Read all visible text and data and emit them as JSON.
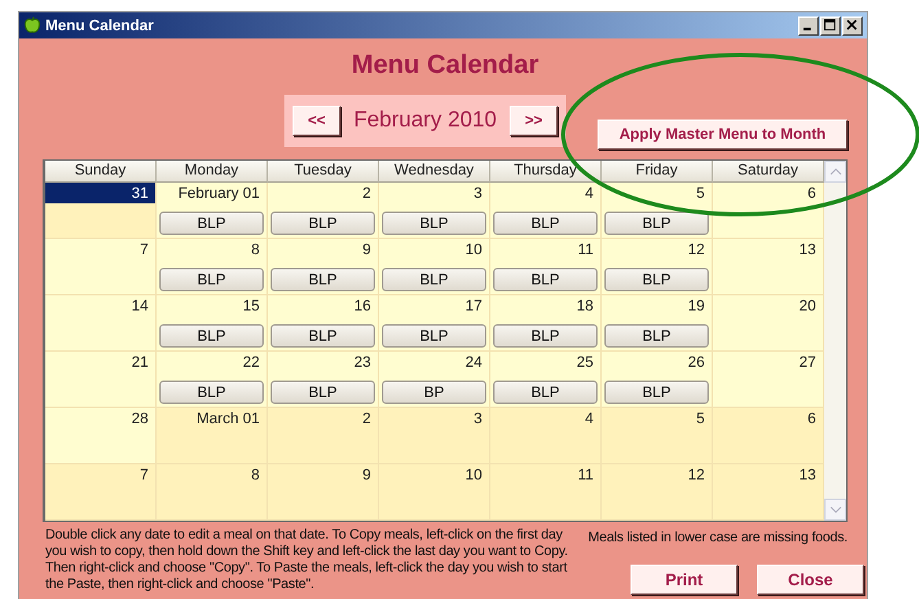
{
  "window": {
    "title": "Menu Calendar"
  },
  "heading": "Menu Calendar",
  "nav": {
    "prev": "<<",
    "month": "February 2010",
    "next": ">>"
  },
  "apply_button": "Apply Master Menu to Month",
  "columns": [
    "Sunday",
    "Monday",
    "Tuesday",
    "Wednesday",
    "Thursday",
    "Friday",
    "Saturday"
  ],
  "weeks": [
    [
      {
        "label": "31",
        "in_month": false,
        "selected": true
      },
      {
        "label": "February 01",
        "in_month": true,
        "selected": false,
        "meal": "BLP"
      },
      {
        "label": "2",
        "in_month": true,
        "selected": false,
        "meal": "BLP"
      },
      {
        "label": "3",
        "in_month": true,
        "selected": false,
        "meal": "BLP"
      },
      {
        "label": "4",
        "in_month": true,
        "selected": false,
        "meal": "BLP"
      },
      {
        "label": "5",
        "in_month": true,
        "selected": false,
        "meal": "BLP"
      },
      {
        "label": "6",
        "in_month": true,
        "selected": false
      }
    ],
    [
      {
        "label": "7",
        "in_month": true,
        "selected": false
      },
      {
        "label": "8",
        "in_month": true,
        "selected": false,
        "meal": "BLP"
      },
      {
        "label": "9",
        "in_month": true,
        "selected": false,
        "meal": "BLP"
      },
      {
        "label": "10",
        "in_month": true,
        "selected": false,
        "meal": "BLP"
      },
      {
        "label": "11",
        "in_month": true,
        "selected": false,
        "meal": "BLP"
      },
      {
        "label": "12",
        "in_month": true,
        "selected": false,
        "meal": "BLP"
      },
      {
        "label": "13",
        "in_month": true,
        "selected": false
      }
    ],
    [
      {
        "label": "14",
        "in_month": true,
        "selected": false
      },
      {
        "label": "15",
        "in_month": true,
        "selected": false,
        "meal": "BLP"
      },
      {
        "label": "16",
        "in_month": true,
        "selected": false,
        "meal": "BLP"
      },
      {
        "label": "17",
        "in_month": true,
        "selected": false,
        "meal": "BLP"
      },
      {
        "label": "18",
        "in_month": true,
        "selected": false,
        "meal": "BLP"
      },
      {
        "label": "19",
        "in_month": true,
        "selected": false,
        "meal": "BLP"
      },
      {
        "label": "20",
        "in_month": true,
        "selected": false
      }
    ],
    [
      {
        "label": "21",
        "in_month": true,
        "selected": false
      },
      {
        "label": "22",
        "in_month": true,
        "selected": false,
        "meal": "BLP"
      },
      {
        "label": "23",
        "in_month": true,
        "selected": false,
        "meal": "BLP"
      },
      {
        "label": "24",
        "in_month": true,
        "selected": false,
        "meal": "BP"
      },
      {
        "label": "25",
        "in_month": true,
        "selected": false,
        "meal": "BLP"
      },
      {
        "label": "26",
        "in_month": true,
        "selected": false,
        "meal": "BLP"
      },
      {
        "label": "27",
        "in_month": true,
        "selected": false
      }
    ],
    [
      {
        "label": "28",
        "in_month": true,
        "selected": false
      },
      {
        "label": "March 01",
        "in_month": false,
        "selected": false
      },
      {
        "label": "2",
        "in_month": false,
        "selected": false
      },
      {
        "label": "3",
        "in_month": false,
        "selected": false
      },
      {
        "label": "4",
        "in_month": false,
        "selected": false
      },
      {
        "label": "5",
        "in_month": false,
        "selected": false
      },
      {
        "label": "6",
        "in_month": false,
        "selected": false
      }
    ],
    [
      {
        "label": "7",
        "in_month": false,
        "selected": false
      },
      {
        "label": "8",
        "in_month": false,
        "selected": false
      },
      {
        "label": "9",
        "in_month": false,
        "selected": false
      },
      {
        "label": "10",
        "in_month": false,
        "selected": false
      },
      {
        "label": "11",
        "in_month": false,
        "selected": false
      },
      {
        "label": "12",
        "in_month": false,
        "selected": false
      },
      {
        "label": "13",
        "in_month": false,
        "selected": false
      }
    ]
  ],
  "instructions": "Double click any date to edit a meal on that date.  To Copy meals, left-click on the first day you wish to copy, then hold down the Shift key and left-click the last day you want to Copy.  Then right-click and choose \"Copy\".  To Paste the meals, left-click the day you wish to start the Paste, then right-click and choose \"Paste\".",
  "legend": "Meals listed in lower case are missing foods.",
  "buttons": [
    "Print",
    "Close"
  ]
}
